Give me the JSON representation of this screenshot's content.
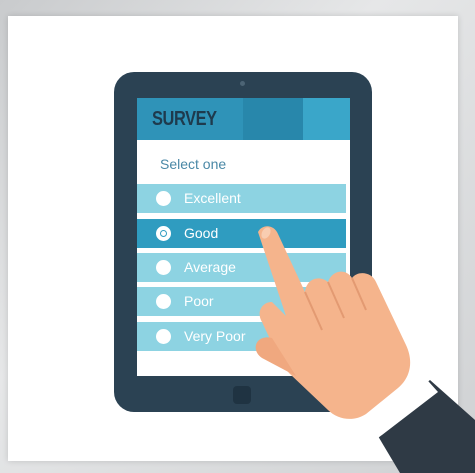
{
  "survey": {
    "header_title": "SURVEY",
    "prompt": "Select one",
    "options": [
      {
        "label": "Excellent",
        "selected": false
      },
      {
        "label": "Good",
        "selected": true
      },
      {
        "label": "Average",
        "selected": false
      },
      {
        "label": "Poor",
        "selected": false
      },
      {
        "label": "Very Poor",
        "selected": false
      }
    ]
  },
  "colors": {
    "tablet_body": "#2b4253",
    "header": "#2f93b8",
    "option_light": "#8dd3e2",
    "option_selected": "#2f9cc0",
    "prompt_text": "#4a88a6",
    "skin": "#f5b48c",
    "sleeve": "#2f3a45"
  },
  "icons": [
    "radio-icon",
    "pointing-hand-icon"
  ]
}
